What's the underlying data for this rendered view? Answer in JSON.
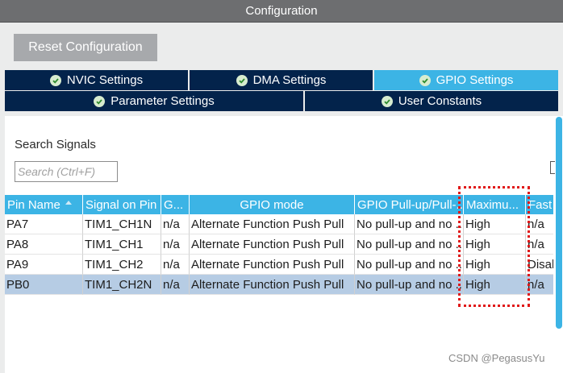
{
  "window": {
    "title": "Configuration"
  },
  "toolbar": {
    "reset_label": "Reset Configuration"
  },
  "tabs": {
    "row1": [
      {
        "label": "NVIC Settings",
        "active": false,
        "icon": "check-circle-icon"
      },
      {
        "label": "DMA Settings",
        "active": false,
        "icon": "check-circle-icon"
      },
      {
        "label": "GPIO Settings",
        "active": true,
        "icon": "check-circle-icon"
      }
    ],
    "row2": [
      {
        "label": "Parameter Settings",
        "active": false,
        "icon": "check-circle-icon"
      },
      {
        "label": "User Constants",
        "active": false,
        "icon": "check-circle-icon"
      }
    ]
  },
  "search": {
    "label": "Search Signals",
    "placeholder": "Search (Ctrl+F)",
    "value": ""
  },
  "table": {
    "columns": [
      "Pin Name",
      "Signal on Pin",
      "G...",
      "GPIO mode",
      "GPIO Pull-up/Pull-...",
      "Maximu...",
      "Fast"
    ],
    "rows": [
      [
        "PA7",
        "TIM1_CH1N",
        "n/a",
        "Alternate Function Push Pull",
        "No pull-up and no ...",
        "High",
        "n/a"
      ],
      [
        "PA8",
        "TIM1_CH1",
        "n/a",
        "Alternate Function Push Pull",
        "No pull-up and no ...",
        "High",
        "n/a"
      ],
      [
        "PA9",
        "TIM1_CH2",
        "n/a",
        "Alternate Function Push Pull",
        "No pull-up and no ...",
        "High",
        "Disal"
      ],
      [
        "PB0",
        "TIM1_CH2N",
        "n/a",
        "Alternate Function Push Pull",
        "No pull-up and no ...",
        "High",
        "n/a"
      ]
    ],
    "selected_row": 3,
    "sorted_column": "Pin Name"
  },
  "colors": {
    "tab_dark": "#03234b",
    "tab_active": "#3cb4e5",
    "header": "#3cb4e5",
    "selection": "#b6cce4",
    "annotation": "#e01818"
  },
  "watermark": "CSDN @PegasusYu"
}
